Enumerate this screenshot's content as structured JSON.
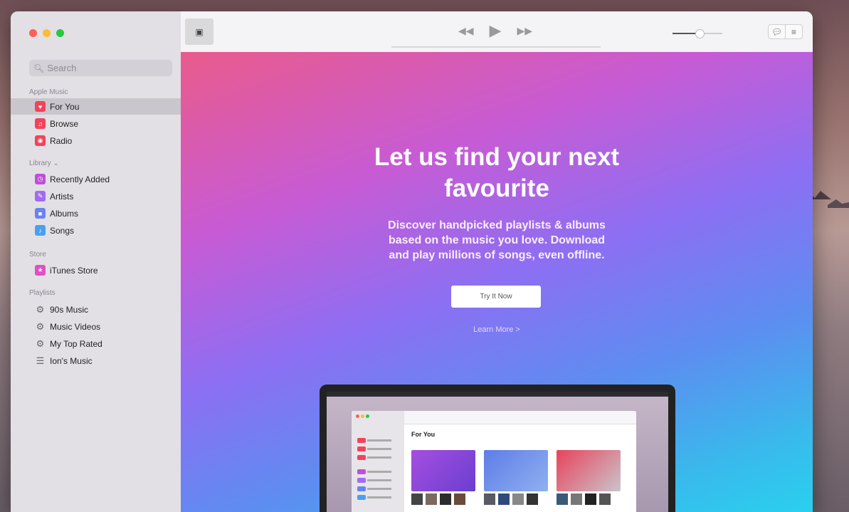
{
  "window": {
    "traffic_colors": [
      "#fe5f57",
      "#febc2e",
      "#28c840"
    ]
  },
  "sidebar": {
    "search_placeholder": "Search",
    "sections": [
      {
        "title": "Apple Music",
        "items": [
          {
            "label": "For You",
            "icon": "heart-icon",
            "color": "#f2435a",
            "selected": true
          },
          {
            "label": "Browse",
            "icon": "music-note-icon",
            "color": "#f2435a",
            "selected": false
          },
          {
            "label": "Radio",
            "icon": "radio-icon",
            "color": "#f2435a",
            "selected": false
          }
        ]
      },
      {
        "title": "Library ⌄",
        "items": [
          {
            "label": "Recently Added",
            "icon": "clock-icon",
            "color": "#c04fd8"
          },
          {
            "label": "Artists",
            "icon": "microphone-icon",
            "color": "#a16cf0"
          },
          {
            "label": "Albums",
            "icon": "album-icon",
            "color": "#6a83f0"
          },
          {
            "label": "Songs",
            "icon": "note-icon",
            "color": "#4aa0f0"
          }
        ]
      },
      {
        "title": "Store",
        "items": [
          {
            "label": "iTunes Store",
            "icon": "star-icon",
            "color": "#e04fc5"
          }
        ]
      },
      {
        "title": "Playlists",
        "items": [
          {
            "label": "90s Music",
            "icon": "gear-icon"
          },
          {
            "label": "Music Videos",
            "icon": "gear-icon"
          },
          {
            "label": "My Top Rated",
            "icon": "gear-icon"
          },
          {
            "label": "Ion's Music",
            "icon": "playlist-icon"
          }
        ]
      }
    ]
  },
  "toolbar": {
    "mini_player_icon": "mini-player-icon",
    "rewind_icon": "rewind-icon",
    "play_icon": "play-icon",
    "forward_icon": "fast-forward-icon",
    "volume_level": 0.5,
    "lyrics_icon": "lyrics-icon",
    "queue_icon": "up-next-icon"
  },
  "hero": {
    "headline_line1": "Let us find your next",
    "headline_line2": "favourite",
    "sub_line1": "Discover handpicked playlists & albums",
    "sub_line2": "based on the music you love. Download",
    "sub_line3": "and play millions of songs, even offline.",
    "try_button": "Try It Now",
    "learn_more": "Learn More >",
    "illustration_title": "For You"
  }
}
